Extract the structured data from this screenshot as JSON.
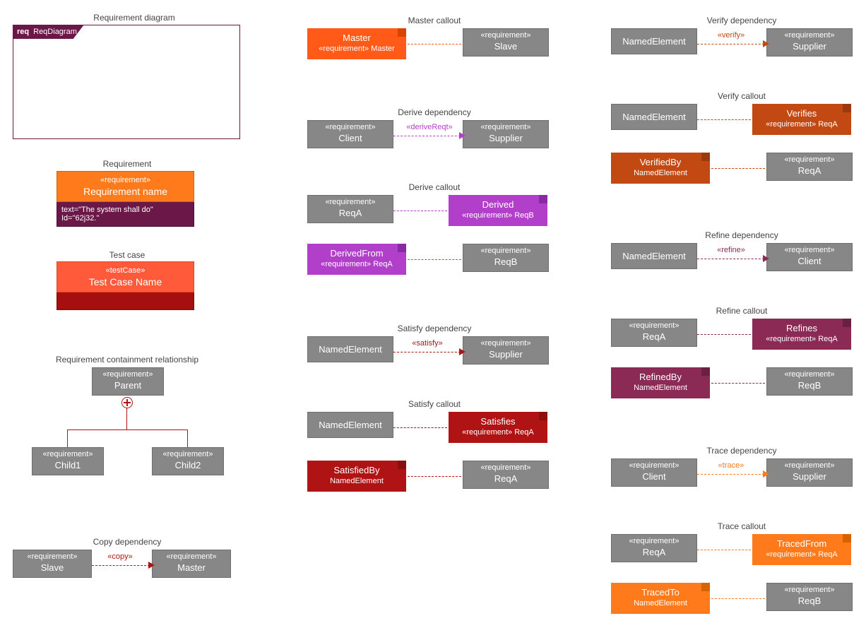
{
  "col1": {
    "reqDiagram": {
      "title": "Requirement diagram",
      "tabReq": "req",
      "tabName": "ReqDiagram"
    },
    "requirement": {
      "title": "Requirement",
      "stereotype": "«requirement»",
      "name": "Requirement name",
      "text": "text=\"The system shall do\"",
      "id": "Id=\"62j32.\""
    },
    "testCase": {
      "title": "Test case",
      "stereotype": "«testCase»",
      "name": "Test Case Name"
    },
    "containment": {
      "title": "Requirement containment relationship",
      "parent": {
        "st": "«requirement»",
        "nm": "Parent"
      },
      "child1": {
        "st": "«requirement»",
        "nm": "Child1"
      },
      "child2": {
        "st": "«requirement»",
        "nm": "Child2"
      }
    },
    "copy": {
      "title": "Copy dependency",
      "slave": {
        "st": "«requirement»",
        "nm": "Slave"
      },
      "master": {
        "st": "«requirement»",
        "nm": "Master"
      },
      "label": "«copy»"
    }
  },
  "col2": {
    "masterCallout": {
      "title": "Master callout",
      "note": {
        "head": "Master",
        "sub": "«requirement» Master"
      },
      "box": {
        "st": "«requirement»",
        "nm": "Slave"
      }
    },
    "deriveDep": {
      "title": "Derive dependency",
      "client": {
        "st": "«requirement»",
        "nm": "Client"
      },
      "supplier": {
        "st": "«requirement»",
        "nm": "Supplier"
      },
      "label": "«deriveReqt»"
    },
    "deriveCallout": {
      "title": "Derive callout",
      "row1": {
        "box": {
          "st": "«requirement»",
          "nm": "ReqA"
        },
        "note": {
          "head": "Derived",
          "sub": "«requirement» ReqB"
        }
      },
      "row2": {
        "note": {
          "head": "DerivedFrom",
          "sub": "«requirement» ReqA"
        },
        "box": {
          "st": "«requirement»",
          "nm": "ReqB"
        }
      }
    },
    "satisfyDep": {
      "title": "Satisfy dependency",
      "client": {
        "nm": "NamedElement"
      },
      "supplier": {
        "st": "«requirement»",
        "nm": "Supplier"
      },
      "label": "«satisfy»"
    },
    "satisfyCallout": {
      "title": "Satisfy callout",
      "row1": {
        "box": {
          "nm": "NamedElement"
        },
        "note": {
          "head": "Satisfies",
          "sub": "«requirement» ReqA"
        }
      },
      "row2": {
        "note": {
          "head": "SatisfiedBy",
          "sub": "NamedElement"
        },
        "box": {
          "st": "«requirement»",
          "nm": "ReqA"
        }
      }
    }
  },
  "col3": {
    "verifyDep": {
      "title": "Verify dependency",
      "client": {
        "nm": "NamedElement"
      },
      "supplier": {
        "st": "«requirement»",
        "nm": "Supplier"
      },
      "label": "«verify»"
    },
    "verifyCallout": {
      "title": "Verify callout",
      "row1": {
        "box": {
          "nm": "NamedElement"
        },
        "note": {
          "head": "Verifies",
          "sub": "«requirement» ReqA"
        }
      },
      "row2": {
        "note": {
          "head": "VerifiedBy",
          "sub": "NamedElement"
        },
        "box": {
          "st": "«requirement»",
          "nm": "ReqA"
        }
      }
    },
    "refineDep": {
      "title": "Refine dependency",
      "client": {
        "nm": "NamedElement"
      },
      "supplier": {
        "st": "«requirement»",
        "nm": "Client"
      },
      "label": "«refine»"
    },
    "refineCallout": {
      "title": "Refine callout",
      "row1": {
        "box": {
          "st": "«requirement»",
          "nm": "ReqA"
        },
        "note": {
          "head": "Refines",
          "sub": "«requirement» ReqA"
        }
      },
      "row2": {
        "note": {
          "head": "RefinedBy",
          "sub": "NamedElement"
        },
        "box": {
          "st": "«requirement»",
          "nm": "ReqB"
        }
      }
    },
    "traceDep": {
      "title": "Trace dependency",
      "client": {
        "st": "«requirement»",
        "nm": "Client"
      },
      "supplier": {
        "st": "«requirement»",
        "nm": "Supplier"
      },
      "label": "«trace»"
    },
    "traceCallout": {
      "title": "Trace callout",
      "row1": {
        "box": {
          "st": "«requirement»",
          "nm": "ReqA"
        },
        "note": {
          "head": "TracedFrom",
          "sub": "«requirement» ReqA"
        }
      },
      "row2": {
        "note": {
          "head": "TracedTo",
          "sub": "NamedElement"
        },
        "box": {
          "st": "«requirement»",
          "nm": "ReqB"
        }
      }
    }
  },
  "colors": {
    "gray": "#878787",
    "orange": "#ff6a13",
    "orangeD": "#d65400",
    "purple": "#b13fc9",
    "purpleD": "#8a2aa3",
    "red": "#b01313",
    "redD": "#8a0f0f",
    "brown": "#c24a12",
    "brownD": "#9a3a0e",
    "plum": "#8a2a55",
    "plumD": "#6b1f41",
    "orange2": "#ff7a1a",
    "orange2D": "#d96200",
    "master": "#ff5a17",
    "masterD": "#d94300"
  }
}
